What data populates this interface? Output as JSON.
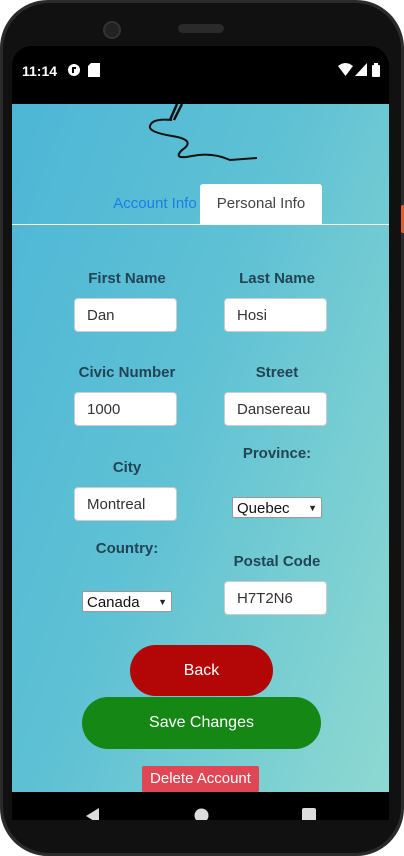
{
  "status_bar": {
    "time": "11:14",
    "icons": [
      "notification-app-icon",
      "sd-card-icon",
      "wifi-icon",
      "signal-icon",
      "battery-icon"
    ]
  },
  "tabs": [
    {
      "label": "Account Info",
      "active": false
    },
    {
      "label": "Personal Info",
      "active": true
    }
  ],
  "form": {
    "first_name": {
      "label": "First Name",
      "value": "Dan"
    },
    "last_name": {
      "label": "Last Name",
      "value": "Hosi"
    },
    "civic_number": {
      "label": "Civic Number",
      "value": "1000"
    },
    "street": {
      "label": "Street",
      "value": "Dansereau"
    },
    "city": {
      "label": "City",
      "value": "Montreal"
    },
    "province": {
      "label": "Province:",
      "selected": "Quebec"
    },
    "country": {
      "label": "Country:",
      "selected": "Canada"
    },
    "postal_code": {
      "label": "Postal Code",
      "value": "H7T2N6"
    }
  },
  "buttons": {
    "back": "Back",
    "save": "Save Changes",
    "delete": "Delete Account"
  },
  "colors": {
    "back": "#b30606",
    "save": "#158715",
    "delete": "#e04653",
    "active_tab_text": "#1a7fe0"
  }
}
